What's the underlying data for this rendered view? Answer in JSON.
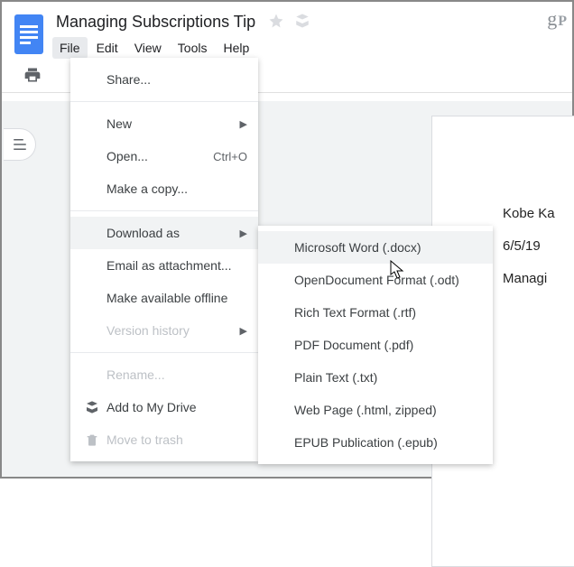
{
  "doc": {
    "title": "Managing Subscriptions Tip"
  },
  "menubar": [
    "File",
    "Edit",
    "View",
    "Tools",
    "Help"
  ],
  "file_menu": {
    "share": "Share...",
    "new": "New",
    "open": "Open...",
    "open_shortcut": "Ctrl+O",
    "copy": "Make a copy...",
    "download": "Download as",
    "email": "Email as attachment...",
    "offline": "Make available offline",
    "version": "Version history",
    "rename": "Rename...",
    "addDrive": "Add to My Drive",
    "trash": "Move to trash"
  },
  "download_submenu": [
    "Microsoft Word (.docx)",
    "OpenDocument Format (.odt)",
    "Rich Text Format (.rtf)",
    "PDF Document (.pdf)",
    "Plain Text (.txt)",
    "Web Page (.html, zipped)",
    "EPUB Publication (.epub)"
  ],
  "page_content": {
    "line1": "Kobe Ka",
    "line2": "6/5/19",
    "line3": "Managi"
  }
}
